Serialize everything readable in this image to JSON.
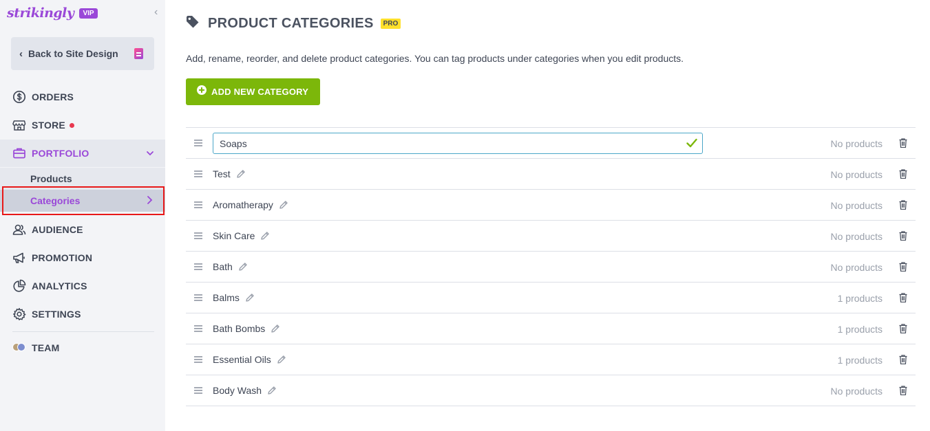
{
  "sidebar": {
    "logo": "strikingly",
    "vip_badge": "VIP",
    "back_label": "Back to Site Design",
    "nav": {
      "orders": "ORDERS",
      "store": "STORE",
      "portfolio": "PORTFOLIO",
      "audience": "AUDIENCE",
      "promotion": "PROMOTION",
      "analytics": "ANALYTICS",
      "settings": "SETTINGS",
      "team": "TEAM"
    },
    "portfolio_sub": {
      "products": "Products",
      "categories": "Categories"
    }
  },
  "main": {
    "title": "PRODUCT CATEGORIES",
    "pro_badge": "PRO",
    "description": "Add, rename, reorder, and delete product categories. You can tag products under categories when you edit products.",
    "add_button": "ADD NEW CATEGORY",
    "categories": [
      {
        "name": "Soaps",
        "count": "No products",
        "editing": true
      },
      {
        "name": "Test",
        "count": "No products"
      },
      {
        "name": "Aromatherapy",
        "count": "No products"
      },
      {
        "name": "Skin Care",
        "count": "No products"
      },
      {
        "name": "Bath",
        "count": "No products"
      },
      {
        "name": "Balms",
        "count": "1 products"
      },
      {
        "name": "Bath Bombs",
        "count": "1 products"
      },
      {
        "name": "Essential Oils",
        "count": "1 products"
      },
      {
        "name": "Body Wash",
        "count": "No products"
      }
    ]
  },
  "colors": {
    "brand": "#9a48d8",
    "accent_green": "#7cb70a",
    "pro_yellow": "#ffe02b",
    "store_dot": "#e8384f",
    "highlight": "#e81818"
  },
  "icons": {
    "orders": "dollar-circle-icon",
    "store": "storefront-icon",
    "portfolio": "briefcase-icon",
    "audience": "people-icon",
    "promotion": "megaphone-icon",
    "analytics": "pie-chart-icon",
    "settings": "gear-icon",
    "team": "team-avatars-icon"
  }
}
